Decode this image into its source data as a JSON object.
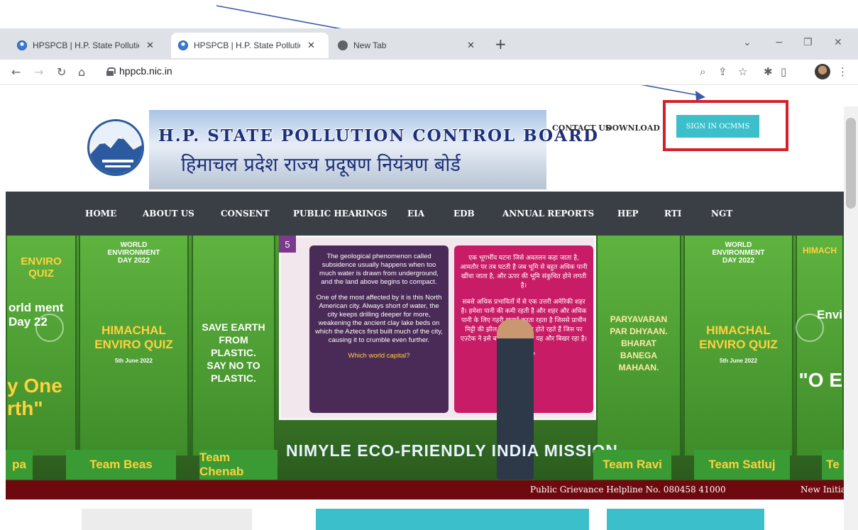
{
  "browser": {
    "tabs": [
      {
        "title": "HPSPCB | H.P. State Pollution Co",
        "active": false
      },
      {
        "title": "HPSPCB | H.P. State Pollution Co",
        "active": true
      },
      {
        "title": "New Tab",
        "active": false
      }
    ],
    "url": "hppcb.nic.in"
  },
  "site": {
    "title_en": "H.P. STATE POLLUTION CONTROL BOARD",
    "title_hi": "हिमाचल प्रदेश राज्य प्रदूषण नियंत्रण बोर्ड",
    "top_links": [
      "CONTACT US",
      "DOWNLOAD"
    ],
    "signin_label": "SIGN IN OCMMS",
    "nav": [
      "HOME",
      "ABOUT US",
      "CONSENT",
      "PUBLIC HEARINGS",
      "EIA",
      "EDB",
      "ANNUAL REPORTS",
      "HEP",
      "RTI",
      "NGT"
    ]
  },
  "slide": {
    "number": "5",
    "card_en": [
      "The geological phenomenon called subsidence usually happens when too much water is drawn from underground, and the land above begins to compact.",
      "One of the most affected by it is this North American city. Always short of water, the city keeps drilling deeper for more, weakening the ancient clay lake beds on which the Aztecs first built much of the city, causing it to crumble even further.",
      "Which world capital?"
    ],
    "card_hi": [
      "एक भूगर्भीय घटना जिसे अवतलन कहा जाता है, आमतौर पर तब घटती है जब भूमि से बहुत अधिक पानी खींचा जाता है, और ऊपर की भूमि संकुचित होने लगती है।",
      "सबसे अधिक प्रभावितों में से एक उत्तरी अमेरिकी शहर है। हमेशा पानी की कमी रहती है और शहर और अधिक पानी के लिए गहरी खुदाई करता रहता है जिससे प्राचीन मिट्टी की झील के तल कमजोर होते रहते हैं जिस पर एज़्टेक ने इसे बनाया था, जिससे यह और बिखर रहा है।",
      "राजधानी?"
    ],
    "banner": "NIMYLE ECO-FRIENDLY INDIA MISSION",
    "panels": {
      "left1": {
        "title": "ENVIRO QUIZ",
        "sub": "orld ment Day 22",
        "bottom": "y One rth\""
      },
      "left2": {
        "top": "WORLD ENVIRONMENT DAY 2022",
        "mid": "HIMACHAL ENVIRO QUIZ",
        "date": "5th June 2022"
      },
      "left3": {
        "text": "SAVE EARTH FROM PLASTIC. SAY NO TO PLASTIC."
      },
      "right1": {
        "text": "PARYAVARAN PAR DHYAAN. BHARAT BANEGA MAHAAN."
      },
      "right2": {
        "top": "WORLD ENVIRONMENT DAY 2022",
        "mid": "HIMACHAL ENVIRO QUIZ",
        "date": "5th June 2022"
      },
      "right3": {
        "title": "HIMACH",
        "sub": "Envi",
        "bottom": "\"O E"
      }
    },
    "teams": [
      "pa",
      "Team Beas",
      "Team Chenab",
      "Team Ravi",
      "Team Satluj",
      "Te"
    ]
  },
  "ticker": {
    "text": "Public Grievance Helpline No. 080458 41000",
    "text2": "New Initia"
  },
  "colors": {
    "accent": "#3bbfca",
    "nav_bg": "#3a3f46",
    "ticker_bg": "#6e0a0f",
    "highlight": "#d3202a"
  }
}
